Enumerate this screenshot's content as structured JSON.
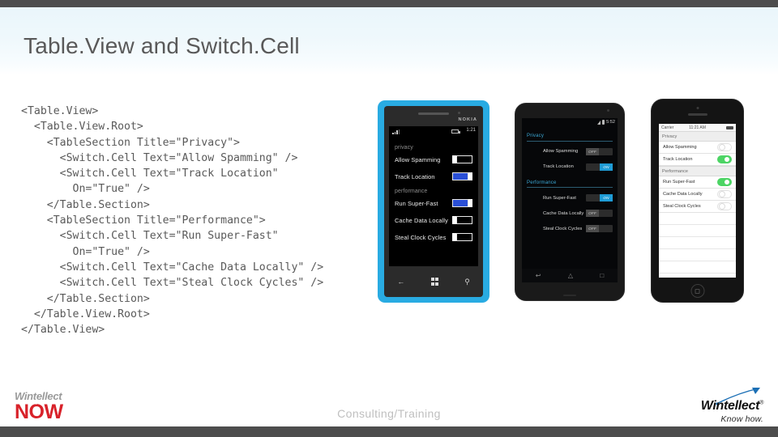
{
  "slide": {
    "title": "Table.View and Switch.Cell"
  },
  "code": {
    "text": "<Table.View>\n  <Table.View.Root>\n    <TableSection Title=\"Privacy\">\n      <Switch.Cell Text=\"Allow Spamming\" />\n      <Switch.Cell Text=\"Track Location\"\n        On=\"True\" />\n    </Table.Section>\n    <TableSection Title=\"Performance\">\n      <Switch.Cell Text=\"Run Super-Fast\"\n        On=\"True\" />\n      <Switch.Cell Text=\"Cache Data Locally\" />\n      <Switch.Cell Text=\"Steal Clock Cycles\" />\n    </Table.Section>\n  </Table.View.Root>\n</Table.View>"
  },
  "devices": {
    "windows_phone": {
      "brand": "NOKIA",
      "status": {
        "time": "1:21"
      },
      "sections": [
        {
          "title": "privacy",
          "rows": [
            {
              "label": "Allow Spamming",
              "on": false
            },
            {
              "label": "Track Location",
              "on": true
            }
          ]
        },
        {
          "title": "performance",
          "rows": [
            {
              "label": "Run Super-Fast",
              "on": true
            },
            {
              "label": "Cache Data Locally",
              "on": false
            },
            {
              "label": "Steal Clock Cycles",
              "on": false
            }
          ]
        }
      ],
      "nav": {
        "back": "←",
        "search": "⚲"
      },
      "accent_color": "#2a4fd6",
      "bezel_color": "#29abe2"
    },
    "android": {
      "status": {
        "time": "5:52"
      },
      "sections": [
        {
          "title": "Privacy",
          "rows": [
            {
              "label": "Allow Spamming",
              "on": false,
              "state_text": "OFF"
            },
            {
              "label": "Track Location",
              "on": true,
              "state_text": "ON"
            }
          ]
        },
        {
          "title": "Performance",
          "rows": [
            {
              "label": "Run Super-Fast",
              "on": true,
              "state_text": "ON"
            },
            {
              "label": "Cache Data Locally",
              "on": false,
              "state_text": "OFF"
            },
            {
              "label": "Steal Clock Cycles",
              "on": false,
              "state_text": "OFF"
            }
          ]
        }
      ],
      "nav": {
        "back": "↩",
        "home": "△",
        "recents": "□"
      },
      "accent_color": "#1f9cd6"
    },
    "iphone": {
      "status": {
        "carrier": "Carrier",
        "wifi": "▾",
        "time": "11:21 AM"
      },
      "sections": [
        {
          "title": "Privacy",
          "rows": [
            {
              "label": "Allow Spamming",
              "on": false
            },
            {
              "label": "Track Location",
              "on": true
            }
          ]
        },
        {
          "title": "Performance",
          "rows": [
            {
              "label": "Run Super-Fast",
              "on": true
            },
            {
              "label": "Cache Data Locally",
              "on": false
            },
            {
              "label": "Steal Clock Cycles",
              "on": false
            }
          ]
        }
      ],
      "accent_color": "#4cd464"
    }
  },
  "footer": {
    "logo_top": "Wintellect",
    "logo_bottom": "NOW",
    "center": "Consulting/Training",
    "right_main": "Wintellect",
    "right_reg": "®",
    "right_sub": "Know how."
  }
}
